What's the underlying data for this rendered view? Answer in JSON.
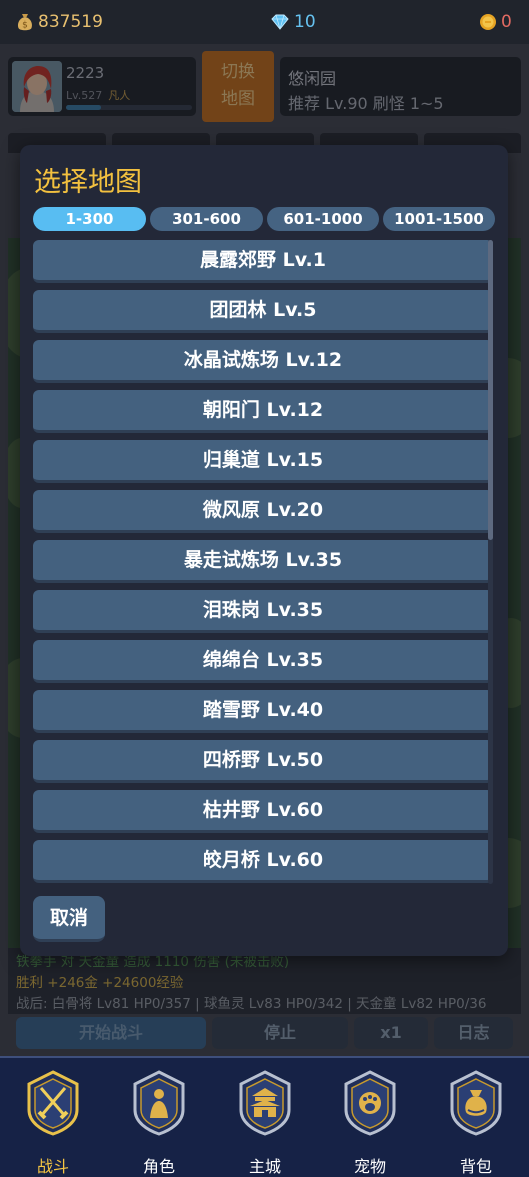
{
  "topbar": {
    "gold": "837519",
    "diamonds": "10",
    "coins": "0",
    "gold_icon": "money-bag-icon",
    "diamond_icon": "diamond-icon",
    "coin_icon": "coin-icon"
  },
  "hero": {
    "name": "2223",
    "level": "Lv.527",
    "rank": "凡人",
    "exp_fraction": 0.28
  },
  "switch_map": {
    "line1": "切换",
    "line2": "地图"
  },
  "current_map": {
    "name": "悠闲园",
    "recommend": "推荐 Lv.90  刷怪 1~5"
  },
  "modal": {
    "title": "选择地图",
    "tabs": [
      {
        "label": "1-300",
        "active": true
      },
      {
        "label": "301-600",
        "active": false
      },
      {
        "label": "601-1000",
        "active": false
      },
      {
        "label": "1001-1500",
        "active": false
      }
    ],
    "maps": [
      {
        "label": "晨露郊野  Lv.1"
      },
      {
        "label": "团团林  Lv.5"
      },
      {
        "label": "冰晶试炼场  Lv.12"
      },
      {
        "label": "朝阳门  Lv.12"
      },
      {
        "label": "归巢道  Lv.15"
      },
      {
        "label": "微风原  Lv.20"
      },
      {
        "label": "暴走试炼场  Lv.35"
      },
      {
        "label": "泪珠岗  Lv.35"
      },
      {
        "label": "绵绵台  Lv.35"
      },
      {
        "label": "踏雪野  Lv.40"
      },
      {
        "label": "四桥野  Lv.50"
      },
      {
        "label": "枯井野  Lv.60"
      },
      {
        "label": "皎月桥  Lv.60"
      }
    ],
    "cancel_label": "取消"
  },
  "battle_log": {
    "line1": "铁拳手 对 天金童 造成 1110 伤害 (未被击败)",
    "line2": "胜利 +246金 +24600经验",
    "line3": "战后: 白骨将 Lv81 HP0/357 | 球鱼灵 Lv83 HP0/342 | 天金童 Lv82 HP0/36"
  },
  "actions": {
    "start": "开始战斗",
    "stop": "停止",
    "speed": "x1",
    "log": "日志"
  },
  "nav": [
    {
      "label": "战斗",
      "icon": "crossed-swords-icon",
      "active": true
    },
    {
      "label": "角色",
      "icon": "character-icon",
      "active": false
    },
    {
      "label": "主城",
      "icon": "castle-icon",
      "active": false
    },
    {
      "label": "宠物",
      "icon": "paw-icon",
      "active": false
    },
    {
      "label": "背包",
      "icon": "bag-icon",
      "active": false
    }
  ],
  "colors": {
    "accent_gold": "#f3c13f",
    "tab_active": "#58bdf2",
    "tab_inactive": "#456382",
    "switch_orange": "#c7711e",
    "nav_bg": "#162246"
  }
}
